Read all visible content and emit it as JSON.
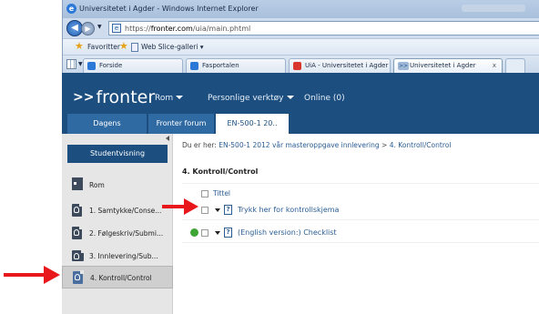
{
  "browser": {
    "window_title": "Universitetet i Agder - Windows Internet Explorer",
    "url_prefix": "https://",
    "url_host": "fronter.com",
    "url_path": "/uia/main.phtml",
    "favorites_label": "Favoritter",
    "web_slice_label": "Web Slice-galleri ▾",
    "tabs": [
      {
        "label": "Forside"
      },
      {
        "label": "Fasportalen"
      },
      {
        "label": "UiA - Universitetet i Agder"
      },
      {
        "label": "Universitetet i Agder",
        "close": "x"
      }
    ]
  },
  "fronter": {
    "logo_arrows": ">>",
    "logo_text": "fronter",
    "menu": {
      "rom": "Rom",
      "tools": "Personlige verktøy",
      "online": "Online (0)"
    },
    "subtabs": [
      "Dagens",
      "Fronter forum",
      "EN-500-1 20.."
    ],
    "sidebar": {
      "studentvisning": "Studentvisning",
      "items": [
        {
          "label": "Rom"
        },
        {
          "label": "1. Samtykke/Conse..."
        },
        {
          "label": "2. Følgeskriv/Submi..."
        },
        {
          "label": "3. Innlevering/Sub..."
        },
        {
          "label": "4. Kontroll/Control"
        }
      ]
    },
    "breadcrumb": {
      "prefix": "Du er her:",
      "link": "EN-500-1 2012 vår masteroppgave innlevering",
      "separator": ">",
      "current": "4. Kontroll/Control"
    },
    "heading": "4. Kontroll/Control",
    "column_title": "Tittel",
    "rows": [
      {
        "label": "Trykk her for kontrollskjema"
      },
      {
        "label": "(English version:) Checklist"
      }
    ]
  },
  "colors": {
    "fronter_blue": "#1c4f80",
    "annotation_red": "#e8171b",
    "status_green": "#3ea535"
  }
}
